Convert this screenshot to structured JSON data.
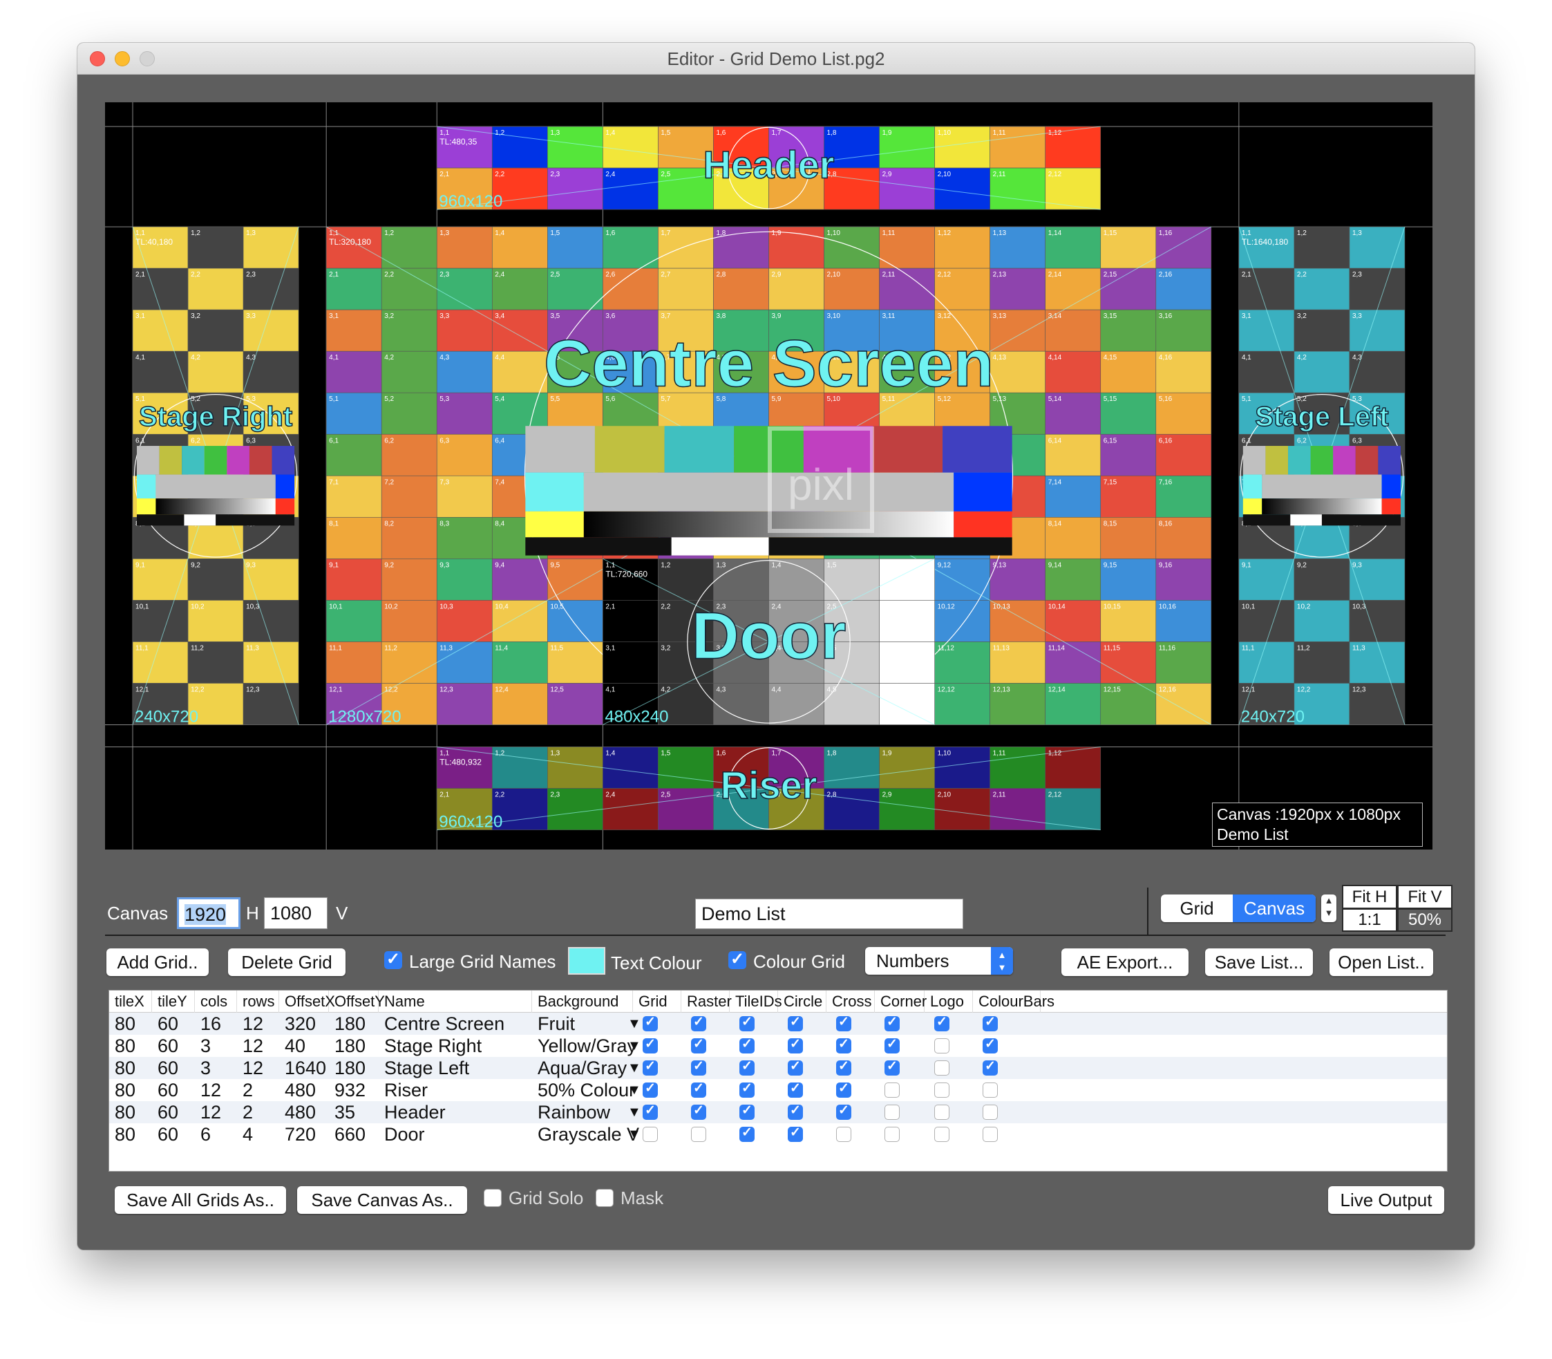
{
  "window": {
    "title": "Editor - Grid Demo List.pg2"
  },
  "preview": {
    "canvas_info_1": "Canvas  :1920px x 1080px",
    "canvas_info_2": "Demo List",
    "logo_text": "pixl",
    "screens": [
      {
        "name": "Header",
        "tl": "TL:480,35",
        "size": "960x120",
        "cols": 12,
        "rows": 2,
        "palette": "rainbow"
      },
      {
        "name": "Stage Right",
        "tl": "TL:40,180",
        "size": "240x720",
        "cols": 3,
        "rows": 12,
        "palette": "yellowgray"
      },
      {
        "name": "Centre Screen",
        "tl": "TL:320,180",
        "size": "1280x720",
        "cols": 16,
        "rows": 12,
        "palette": "fruit"
      },
      {
        "name": "Stage Left",
        "tl": "TL:1640,180",
        "size": "240x720",
        "cols": 3,
        "rows": 12,
        "palette": "aquagray"
      },
      {
        "name": "Door",
        "tl": "TL:720,660",
        "size": "480x240",
        "cols": 6,
        "rows": 4,
        "palette": "grayscale"
      },
      {
        "name": "Riser",
        "tl": "TL:480,932",
        "size": "960x120",
        "cols": 12,
        "rows": 2,
        "palette": "colour50"
      }
    ],
    "colors": {
      "fruit": [
        "#e64d3c",
        "#f0a83a",
        "#f2c94c",
        "#5aa84a",
        "#3d8fd9",
        "#8e44ad",
        "#e67e3a",
        "#3cb371"
      ],
      "rainbow": [
        "#9b3fd6",
        "#0033e6",
        "#55e63a",
        "#f2e63a",
        "#f0a83a",
        "#ff3b1f"
      ],
      "yellowgray": [
        "#f0d24a",
        "#444444"
      ],
      "aquagray": [
        "#3ab0c0",
        "#444444"
      ],
      "colour50": [
        "#7a1f86",
        "#238a8a",
        "#8a8a23",
        "#1a1a8a",
        "#238a23",
        "#8a1a1a"
      ],
      "label": "#6ff2f2"
    }
  },
  "controls": {
    "canvas_label": "Canvas",
    "canvas_w": "1920",
    "h_label": "H",
    "canvas_h": "1080",
    "v_label": "V",
    "list_name": "Demo List",
    "seg_grid": "Grid",
    "seg_canvas": "Canvas",
    "fit_h": "Fit H",
    "fit_v": "Fit V",
    "zoom_1_1": "1:1",
    "zoom_pct": "50%",
    "add_grid": "Add Grid..",
    "delete_grid": "Delete Grid",
    "large_grid_names": "Large Grid Names",
    "text_colour": "Text Colour",
    "colour_grid": "Colour Grid",
    "numbers": "Numbers",
    "ae_export": "AE Export...",
    "save_list": "Save List...",
    "open_list": "Open List..",
    "save_all_grids": "Save All Grids As..",
    "save_canvas": "Save Canvas As..",
    "grid_solo": "Grid Solo",
    "mask": "Mask",
    "live_output": "Live Output"
  },
  "table": {
    "headers": [
      "tileX",
      "tileY",
      "cols",
      "rows",
      "OffsetX",
      "OffsetY",
      "Name",
      "Background",
      "Grid",
      "Raster",
      "TileIDs",
      "Circle",
      "Cross",
      "Corner",
      "Logo",
      "ColourBars"
    ],
    "rows": [
      {
        "tileX": "80",
        "tileY": "60",
        "cols": "16",
        "rows": "12",
        "offx": "320",
        "offy": "180",
        "name": "Centre Screen",
        "bg": "Fruit",
        "checks": [
          true,
          true,
          true,
          true,
          true,
          true,
          true,
          true
        ]
      },
      {
        "tileX": "80",
        "tileY": "60",
        "cols": "3",
        "rows": "12",
        "offx": "40",
        "offy": "180",
        "name": "Stage Right",
        "bg": "Yellow/Gray",
        "checks": [
          true,
          true,
          true,
          true,
          true,
          true,
          false,
          true
        ]
      },
      {
        "tileX": "80",
        "tileY": "60",
        "cols": "3",
        "rows": "12",
        "offx": "1640",
        "offy": "180",
        "name": "Stage Left",
        "bg": "Aqua/Gray",
        "checks": [
          true,
          true,
          true,
          true,
          true,
          true,
          false,
          true
        ]
      },
      {
        "tileX": "80",
        "tileY": "60",
        "cols": "12",
        "rows": "2",
        "offx": "480",
        "offy": "932",
        "name": "Riser",
        "bg": "50% Colour",
        "checks": [
          true,
          true,
          true,
          true,
          true,
          false,
          false,
          false
        ]
      },
      {
        "tileX": "80",
        "tileY": "60",
        "cols": "12",
        "rows": "2",
        "offx": "480",
        "offy": "35",
        "name": "Header",
        "bg": "Rainbow",
        "checks": [
          true,
          true,
          true,
          true,
          true,
          false,
          false,
          false
        ]
      },
      {
        "tileX": "80",
        "tileY": "60",
        "cols": "6",
        "rows": "4",
        "offx": "720",
        "offy": "660",
        "name": "Door",
        "bg": "Grayscale V",
        "checks": [
          false,
          false,
          true,
          true,
          false,
          false,
          false,
          false
        ]
      }
    ]
  }
}
